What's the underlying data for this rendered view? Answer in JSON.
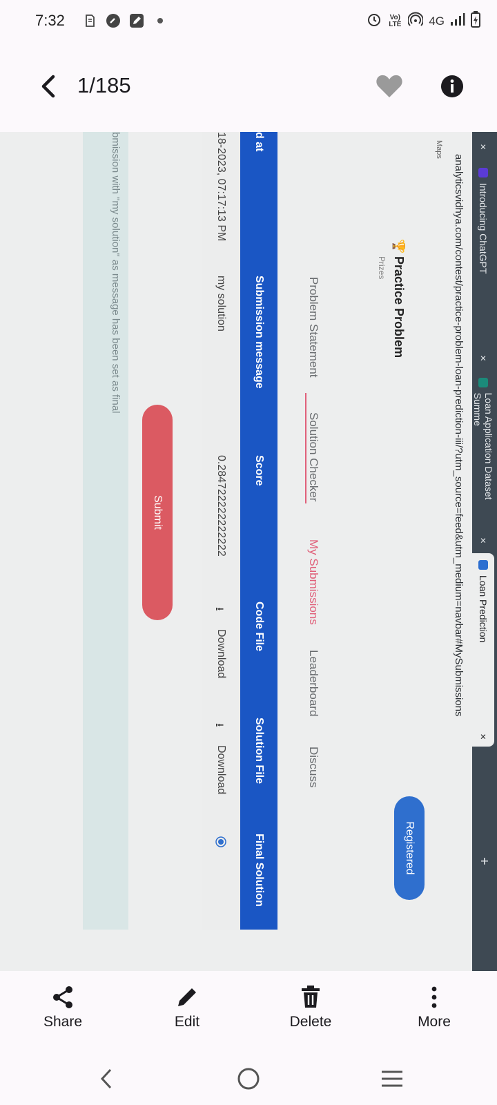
{
  "status_bar": {
    "time": "7:32",
    "network_label": "4G",
    "left_icons": [
      "sim-icon",
      "clock-app-icon",
      "edit-app-icon",
      "dot-icon"
    ],
    "right_icons": [
      "alarm-icon",
      "volte-icon",
      "hotspot-icon",
      "signal-icon",
      "battery-icon"
    ],
    "volte_label": "Vo) LTE"
  },
  "top_bar": {
    "counter": "1/185",
    "favorite_icon": "heart-icon",
    "info_icon": "info-icon"
  },
  "photo": {
    "browser": {
      "tabs": [
        {
          "label": "Introducing ChatGPT",
          "favicon_color": "#5b3bd6",
          "close": "×"
        },
        {
          "label": "Loan Application Dataset Summe",
          "favicon_color": "#1b8a7a",
          "close": "×"
        },
        {
          "label": "Loan Prediction",
          "favicon_color": "#2d6fd0",
          "close": "×"
        }
      ],
      "partial_tab_close": "×",
      "new_tab": "+",
      "url": "analyticsvidhya.com/contest/practice-problem-loan-prediction-iii/?utm_source=feed&utm_medium=navbar#MySubmissions",
      "bookmark_label": "Maps"
    },
    "page": {
      "title": "Practice Problem",
      "subtitle": "Prizes",
      "registered_button": "Registered",
      "nav_tabs": [
        "Problem Statement",
        "Solution Checker",
        "My Submissions",
        "Leaderboard",
        "Discuss"
      ],
      "selected_tab": "My Submissions",
      "table_headers": [
        "d at",
        "Submission message",
        "Score",
        "Code File",
        "Solution File",
        "Final Solution"
      ],
      "row": {
        "submitted_at": "18-2023, 07:17:13 PM",
        "message": "my solution",
        "score": "0.284722222222222",
        "code_file": "Download",
        "solution_file": "Download"
      },
      "submit_button": "Submit",
      "notice": "bmission with \"my solution\" as message has been set as final"
    }
  },
  "bottom_actions": [
    {
      "label": "Share",
      "icon": "share-icon"
    },
    {
      "label": "Edit",
      "icon": "pencil-icon"
    },
    {
      "label": "Delete",
      "icon": "trash-icon"
    },
    {
      "label": "More",
      "icon": "more-vertical-icon"
    }
  ],
  "nav_bar": {
    "icons": [
      "back-nav-icon",
      "home-nav-icon",
      "recents-nav-icon"
    ]
  }
}
